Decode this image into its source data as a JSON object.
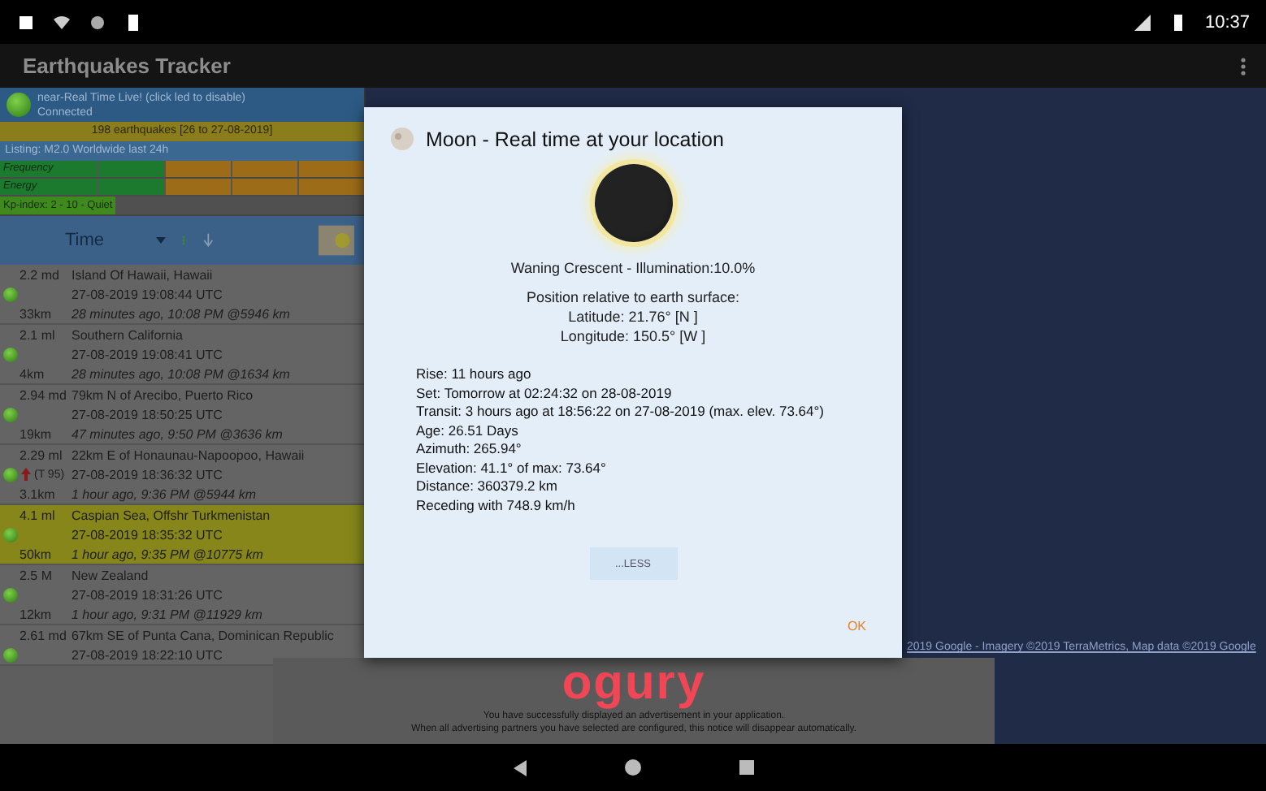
{
  "status_bar": {
    "time": "10:37"
  },
  "app_bar": {
    "title": "Earthquakes Tracker"
  },
  "live_panel": {
    "status": "near-Real Time Live! (click led to disable)",
    "connection": "Connected",
    "summary": "198 earthquakes [26 to 27-08-2019]",
    "listing": "Listing: M2.0 Worldwide last 24h",
    "frequency_label": "Frequency",
    "energy_label": "Energy",
    "kp_index": "Kp-index: 2 - 10 - Quiet"
  },
  "sort": {
    "label": "Time"
  },
  "quakes": [
    {
      "magnitude": "2.2 md",
      "place": "Island Of Hawaii, Hawaii",
      "time": "27-08-2019 19:08:44 UTC",
      "depth": "33km",
      "ago": "28 minutes ago, 10:08 PM @5946 km",
      "highlighted": false,
      "alert": false
    },
    {
      "magnitude": "2.1 ml",
      "place": "Southern California",
      "time": "27-08-2019 19:08:41 UTC",
      "depth": "4km",
      "ago": "28 minutes ago, 10:08 PM @1634 km",
      "highlighted": false,
      "alert": false
    },
    {
      "magnitude": "2.94 md",
      "place": "79km N of Arecibo, Puerto Rico",
      "time": "27-08-2019 18:50:25 UTC",
      "depth": "19km",
      "ago": "47 minutes ago, 9:50 PM @3636 km",
      "highlighted": false,
      "alert": false
    },
    {
      "magnitude": "2.29 ml",
      "place": "22km E of Honaunau-Napoopoo, Hawaii",
      "note": "(T 95)",
      "time": "27-08-2019 18:36:32 UTC",
      "depth": "3.1km",
      "ago": "1 hour ago, 9:36 PM @5944 km",
      "highlighted": false,
      "alert": true
    },
    {
      "magnitude": "4.1 ml",
      "place": "Caspian Sea, Offshr Turkmenistan",
      "time": "27-08-2019 18:35:32 UTC",
      "depth": "50km",
      "ago": "1 hour ago, 9:35 PM @10775 km",
      "highlighted": true,
      "alert": false
    },
    {
      "magnitude": "2.5 M",
      "place": "New Zealand",
      "time": "27-08-2019 18:31:26 UTC",
      "depth": "12km",
      "ago": "1 hour ago, 9:31 PM @11929 km",
      "highlighted": false,
      "alert": false
    },
    {
      "magnitude": "2.61 md",
      "place": "67km SE of Punta Cana, Dominican Republic",
      "time": "27-08-2019 18:22:10 UTC",
      "highlighted": false,
      "alert": false
    }
  ],
  "map": {
    "attribution": "2019 Google - Imagery ©2019 TerraMetrics, Map data ©2019 Google"
  },
  "ad": {
    "logo": "ogury",
    "lines": [
      "You have successfully displayed an advertisement in your application.",
      "When all advertising partners you have selected are configured, this notice will disappear automatically."
    ]
  },
  "dialog": {
    "title": "Moon - Real time at your location",
    "phase": "Waning Crescent - Illumination:10.0%",
    "position_heading": "Position relative to earth surface:",
    "latitude": "Latitude: 21.76° [N ]",
    "longitude": "Longitude: 150.5° [W ]",
    "details": [
      "Rise: 11 hours ago",
      "Set: Tomorrow at 02:24:32 on 28-08-2019",
      "Transit: 3 hours ago at 18:56:22 on 27-08-2019 (max. elev. 73.64°)",
      "Age: 26.51 Days",
      "Azimuth: 265.94°",
      "Elevation: 41.1° of max: 73.64°",
      "Distance: 360379.2 km",
      "Receding with 748.9 km/h"
    ],
    "less_button": "...LESS",
    "ok_button": "OK"
  }
}
